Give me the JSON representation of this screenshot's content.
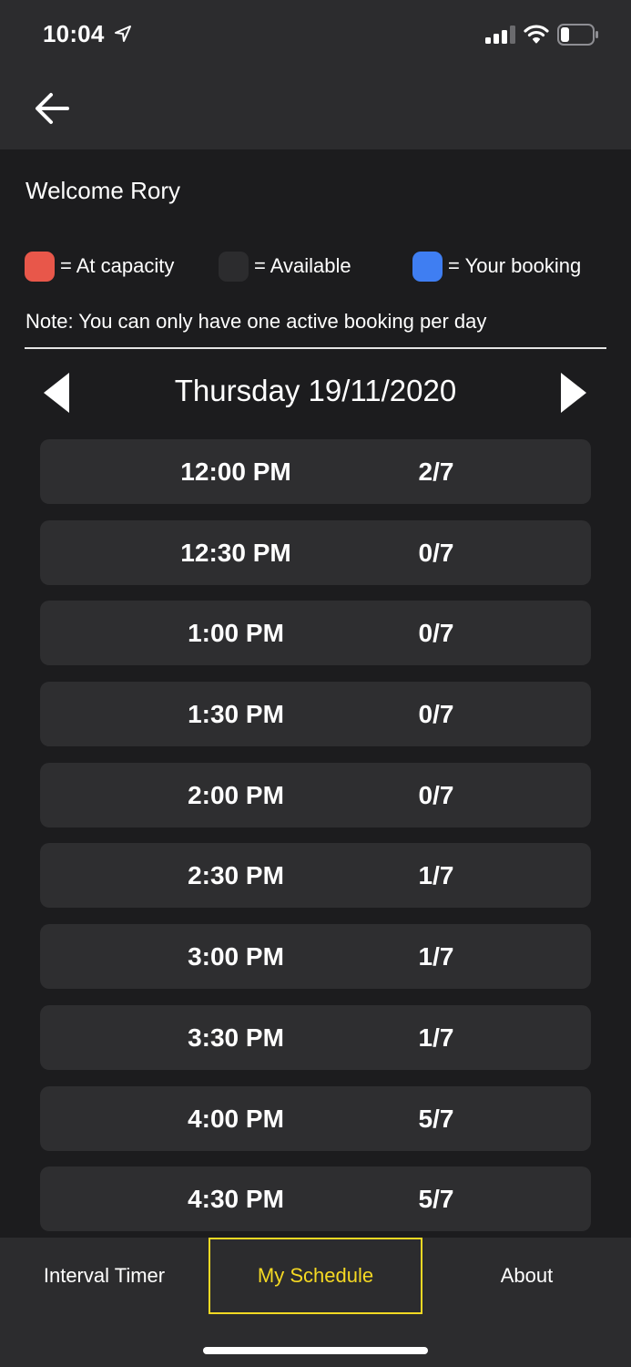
{
  "status_bar": {
    "time": "10:04"
  },
  "welcome": "Welcome Rory",
  "legend": {
    "capacity": {
      "label": "= At capacity",
      "color": "#e8574a"
    },
    "available": {
      "label": "= Available",
      "color": "#2c2c2e"
    },
    "booking": {
      "label": "= Your booking",
      "color": "#3f7ef2"
    }
  },
  "note": "Note: You can only have one active booking per day",
  "date": "Thursday 19/11/2020",
  "slots": [
    {
      "time": "12:00 PM",
      "count": "2/7"
    },
    {
      "time": "12:30 PM",
      "count": "0/7"
    },
    {
      "time": "1:00 PM",
      "count": "0/7"
    },
    {
      "time": "1:30 PM",
      "count": "0/7"
    },
    {
      "time": "2:00 PM",
      "count": "0/7"
    },
    {
      "time": "2:30 PM",
      "count": "1/7"
    },
    {
      "time": "3:00 PM",
      "count": "1/7"
    },
    {
      "time": "3:30 PM",
      "count": "1/7"
    },
    {
      "time": "4:00 PM",
      "count": "5/7"
    },
    {
      "time": "4:30 PM",
      "count": "5/7"
    }
  ],
  "tabs": {
    "interval": "Interval Timer",
    "schedule": "My Schedule",
    "about": "About"
  },
  "colors": {
    "active_tab": "#f5d923",
    "slot_bg": "#2e2e30",
    "background": "#1c1c1e"
  }
}
